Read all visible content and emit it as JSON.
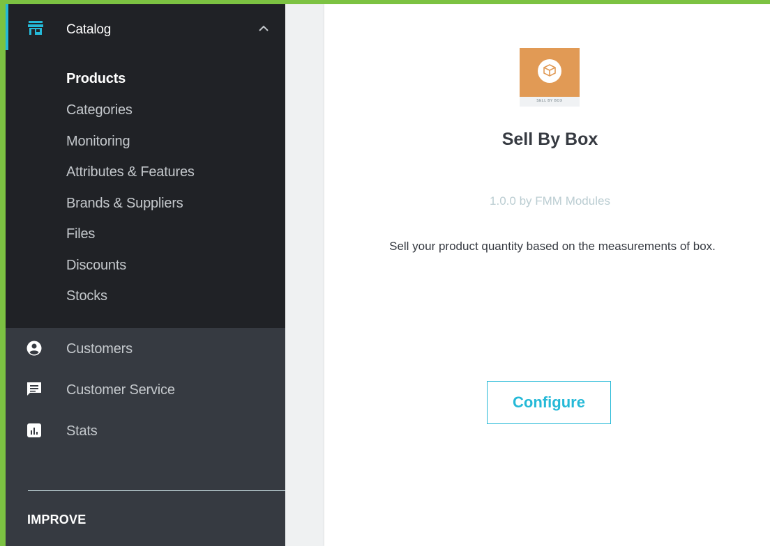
{
  "colors": {
    "frame_border": "#7cc242",
    "sidebar_bg": "#363a41",
    "catalog_bg": "#202226",
    "accent": "#25b9d7",
    "muted_text": "#bbcdd2"
  },
  "sidebar": {
    "catalog": {
      "label": "Catalog",
      "icon": "store-icon",
      "expanded": true,
      "items": [
        {
          "label": "Products",
          "active": true
        },
        {
          "label": "Categories"
        },
        {
          "label": "Monitoring"
        },
        {
          "label": "Attributes & Features"
        },
        {
          "label": "Brands & Suppliers"
        },
        {
          "label": "Files"
        },
        {
          "label": "Discounts"
        },
        {
          "label": "Stocks"
        }
      ]
    },
    "items": [
      {
        "label": "Customers",
        "icon": "account-circle-icon"
      },
      {
        "label": "Customer Service",
        "icon": "chat-icon"
      },
      {
        "label": "Stats",
        "icon": "bar-chart-icon"
      }
    ],
    "section_label": "IMPROVE"
  },
  "module": {
    "logo_caption": "SELL BY BOX",
    "title": "Sell By Box",
    "version_line": "1.0.0 by FMM Modules",
    "description": "Sell your product quantity based on the measurements of box.",
    "configure_label": "Configure"
  }
}
